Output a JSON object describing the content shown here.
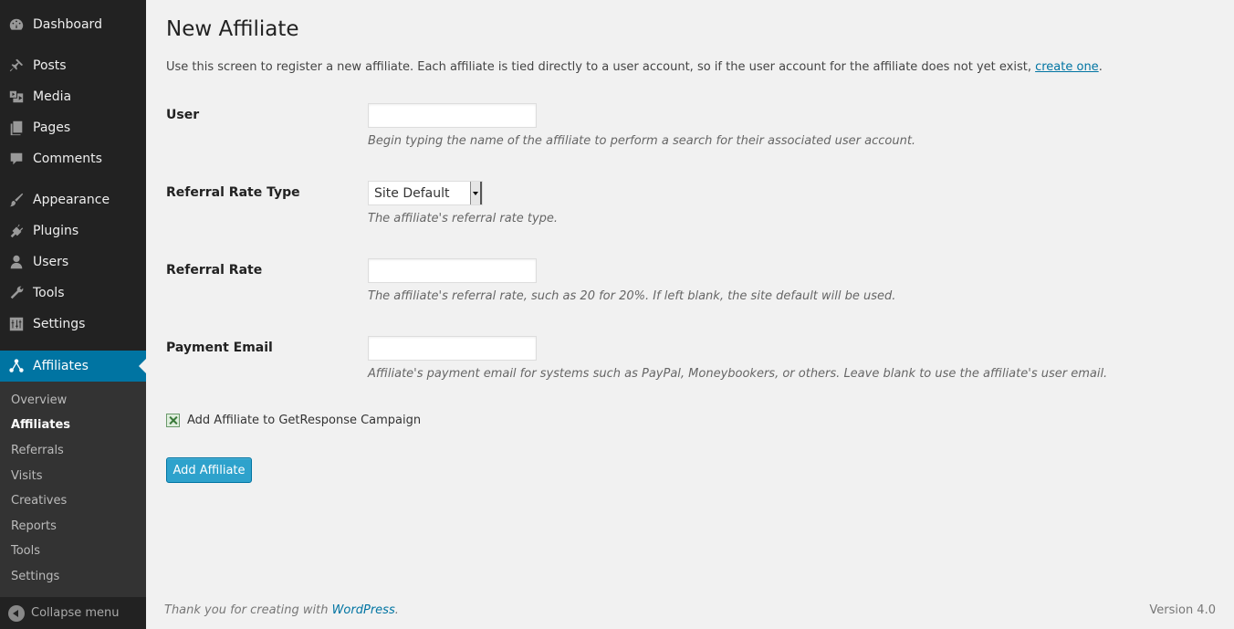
{
  "sidebar": {
    "items": [
      {
        "label": "Dashboard",
        "icon": "dashboard-icon"
      },
      {
        "label": "Posts",
        "icon": "pin-icon"
      },
      {
        "label": "Media",
        "icon": "media-icon"
      },
      {
        "label": "Pages",
        "icon": "pages-icon"
      },
      {
        "label": "Comments",
        "icon": "comment-icon"
      },
      {
        "label": "Appearance",
        "icon": "brush-icon"
      },
      {
        "label": "Plugins",
        "icon": "plug-icon"
      },
      {
        "label": "Users",
        "icon": "user-icon"
      },
      {
        "label": "Tools",
        "icon": "wrench-icon"
      },
      {
        "label": "Settings",
        "icon": "sliders-icon"
      },
      {
        "label": "Affiliates",
        "icon": "network-icon"
      }
    ],
    "submenu": [
      "Overview",
      "Affiliates",
      "Referrals",
      "Visits",
      "Creatives",
      "Reports",
      "Tools",
      "Settings"
    ],
    "collapse_label": "Collapse menu"
  },
  "page": {
    "title": "New Affiliate",
    "intro_text": "Use this screen to register a new affiliate. Each affiliate is tied directly to a user account, so if the user account for the affiliate does not yet exist, ",
    "intro_link": "create one",
    "intro_end": "."
  },
  "form": {
    "user": {
      "label": "User",
      "value": "",
      "description": "Begin typing the name of the affiliate to perform a search for their associated user account."
    },
    "rate_type": {
      "label": "Referral Rate Type",
      "selected": "Site Default",
      "description": "The affiliate's referral rate type."
    },
    "rate": {
      "label": "Referral Rate",
      "value": "",
      "description": "The affiliate's referral rate, such as 20 for 20%. If left blank, the site default will be used."
    },
    "email": {
      "label": "Payment Email",
      "value": "",
      "description": "Affiliate's payment email for systems such as PayPal, Moneybookers, or others. Leave blank to use the affiliate's user email."
    },
    "getresponse_label": "Add Affiliate to GetResponse Campaign",
    "submit_label": "Add Affiliate"
  },
  "footer": {
    "thanks_text": "Thank you for creating with ",
    "thanks_link": "WordPress",
    "thanks_end": ".",
    "version": "Version 4.0"
  },
  "colors": {
    "sidebar_bg": "#222222",
    "active_bg": "#0074a2",
    "button_bg": "#2ea2cc",
    "link": "#0074a2"
  }
}
